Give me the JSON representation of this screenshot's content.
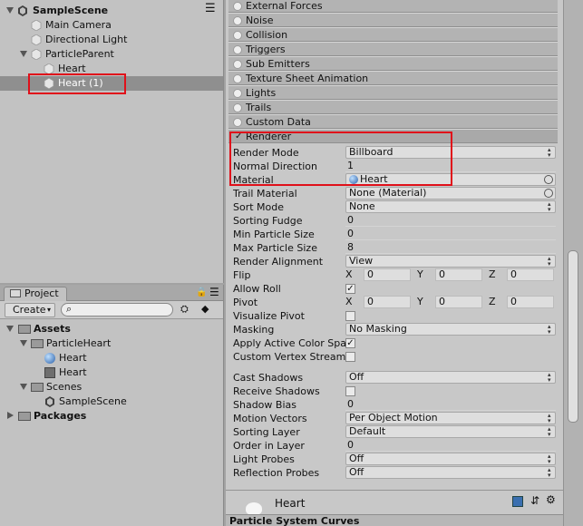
{
  "hierarchy": {
    "scene": "SampleScene",
    "items": [
      "Main Camera",
      "Directional Light",
      "ParticleParent",
      "Heart",
      "Heart (1)"
    ]
  },
  "project": {
    "tab": "Project",
    "create": "Create",
    "tree": [
      "Assets",
      "ParticleHeart",
      "Heart",
      "Heart",
      "Scenes",
      "SampleScene",
      "Packages"
    ]
  },
  "inspector": {
    "modules": [
      "External Forces",
      "Noise",
      "Collision",
      "Triggers",
      "Sub Emitters",
      "Texture Sheet Animation",
      "Lights",
      "Trails",
      "Custom Data"
    ],
    "renderer": {
      "title": "Renderer",
      "check": "✓",
      "props": {
        "render_mode": {
          "name": "Render Mode",
          "value": "Billboard"
        },
        "normal_direction": {
          "name": "Normal Direction",
          "value": "1"
        },
        "material": {
          "name": "Material",
          "value": "Heart"
        },
        "trail_material": {
          "name": "Trail Material",
          "value": "None (Material)"
        },
        "sort_mode": {
          "name": "Sort Mode",
          "value": "None"
        },
        "sorting_fudge": {
          "name": "Sorting Fudge",
          "value": "0"
        },
        "min_particle_size": {
          "name": "Min Particle Size",
          "value": "0"
        },
        "max_particle_size": {
          "name": "Max Particle Size",
          "value": "8"
        },
        "render_alignment": {
          "name": "Render Alignment",
          "value": "View"
        },
        "flip": {
          "name": "Flip",
          "x": "0",
          "y": "0",
          "z": "0"
        },
        "allow_roll": {
          "name": "Allow Roll",
          "value": "✓"
        },
        "pivot": {
          "name": "Pivot",
          "x": "0",
          "y": "0",
          "z": "0"
        },
        "visualize_pivot": {
          "name": "Visualize Pivot",
          "value": ""
        },
        "masking": {
          "name": "Masking",
          "value": "No Masking"
        },
        "apply_active_color_space": {
          "name": "Apply Active Color Space",
          "value": "✓"
        },
        "custom_vertex_streams": {
          "name": "Custom Vertex Streams",
          "value": ""
        },
        "cast_shadows": {
          "name": "Cast Shadows",
          "value": "Off"
        },
        "receive_shadows": {
          "name": "Receive Shadows",
          "value": ""
        },
        "shadow_bias": {
          "name": "Shadow Bias",
          "value": "0"
        },
        "motion_vectors": {
          "name": "Motion Vectors",
          "value": "Per Object Motion"
        },
        "sorting_layer": {
          "name": "Sorting Layer",
          "value": "Default"
        },
        "order_in_layer": {
          "name": "Order in Layer",
          "value": "0"
        },
        "light_probes": {
          "name": "Light Probes",
          "value": "Off"
        },
        "reflection_probes": {
          "name": "Reflection Probes",
          "value": "Off"
        }
      }
    },
    "axes": {
      "x": "X",
      "y": "Y",
      "z": "Z"
    },
    "material_preview": "Heart",
    "curves_title": "Particle System Curves"
  },
  "colors": {
    "highlight": "#e0101a",
    "selection": "#8f8f8f"
  }
}
